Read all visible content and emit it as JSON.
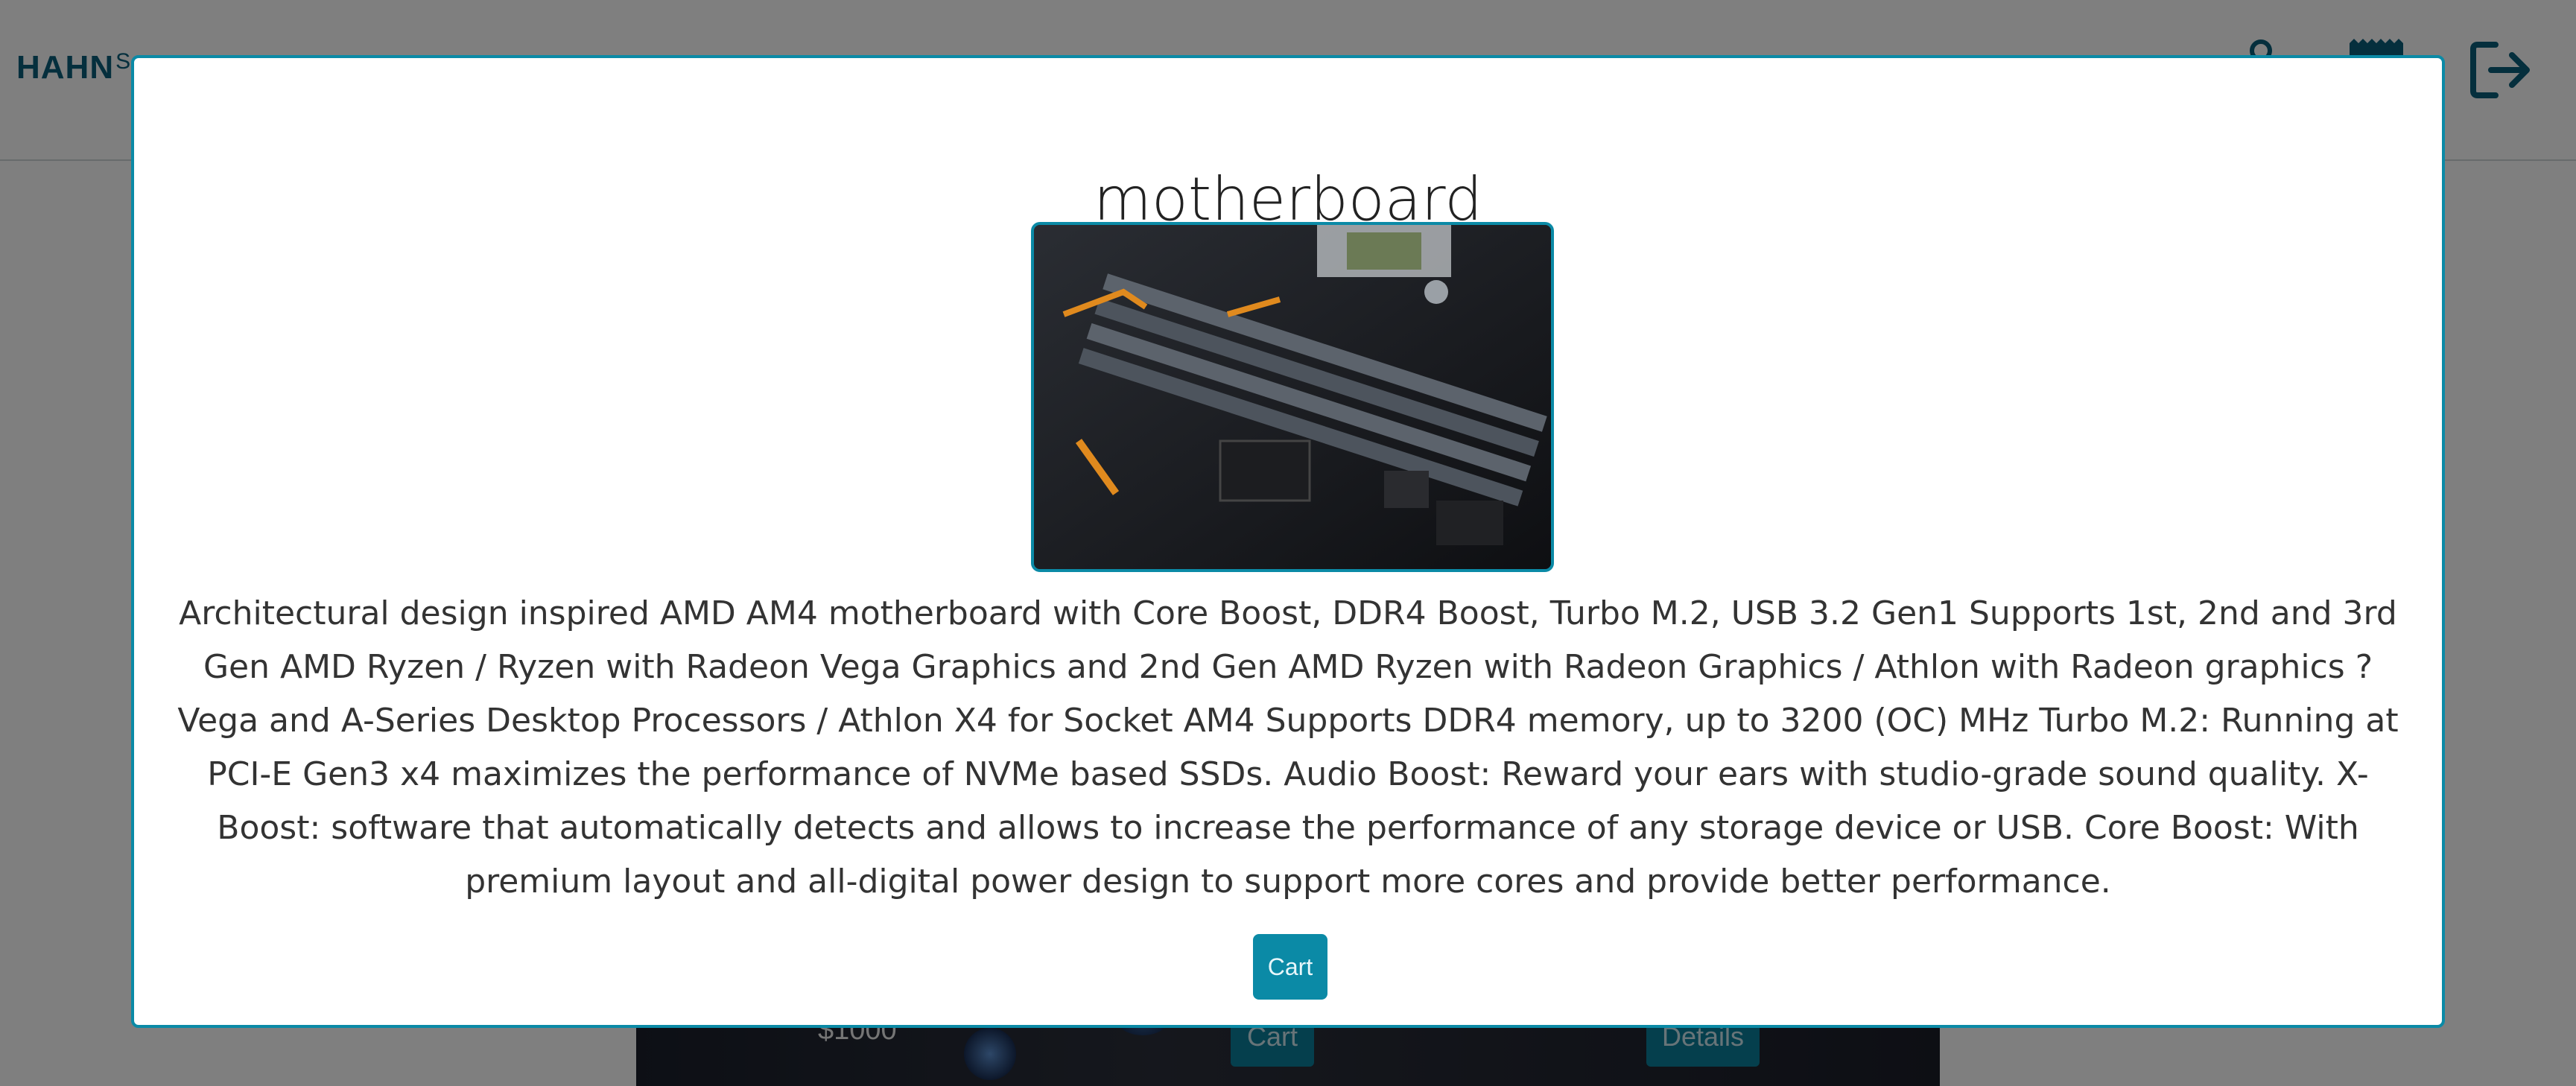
{
  "header": {
    "logo_text": "HAHN",
    "logo_sub": "S",
    "icons": [
      "user-icon",
      "cart-icon",
      "logout-icon"
    ]
  },
  "background_card": {
    "price": "$1000",
    "cart_label": "Cart",
    "details_label": "Details"
  },
  "modal": {
    "title": "motherboard",
    "image": "motherboard-photo",
    "description": "Architectural design inspired AMD AM4 motherboard with Core Boost, DDR4 Boost, Turbo M.2, USB 3.2 Gen1 Supports 1st, 2nd and 3rd Gen AMD Ryzen / Ryzen with Radeon Vega Graphics and 2nd Gen AMD Ryzen with Radeon Graphics / Athlon with Radeon graphics ? Vega and A-Series Desktop Processors / Athlon X4 for Socket AM4 Supports DDR4 memory, up to 3200 (OC) MHz Turbo M.2: Running at PCI-E Gen3 x4 maximizes the performance of NVMe based SSDs. Audio Boost: Reward your ears with studio-grade sound quality. X-Boost: software that automatically detects and allows to increase the performance of any storage device or USB. Core Boost: With premium layout and all-digital power design to support more cores and provide better performance.",
    "cart_label": "Cart"
  },
  "colors": {
    "accent": "#0b8aa6",
    "brand": "#0a5e7a",
    "overlay": "rgba(0,0,0,0.5)"
  }
}
